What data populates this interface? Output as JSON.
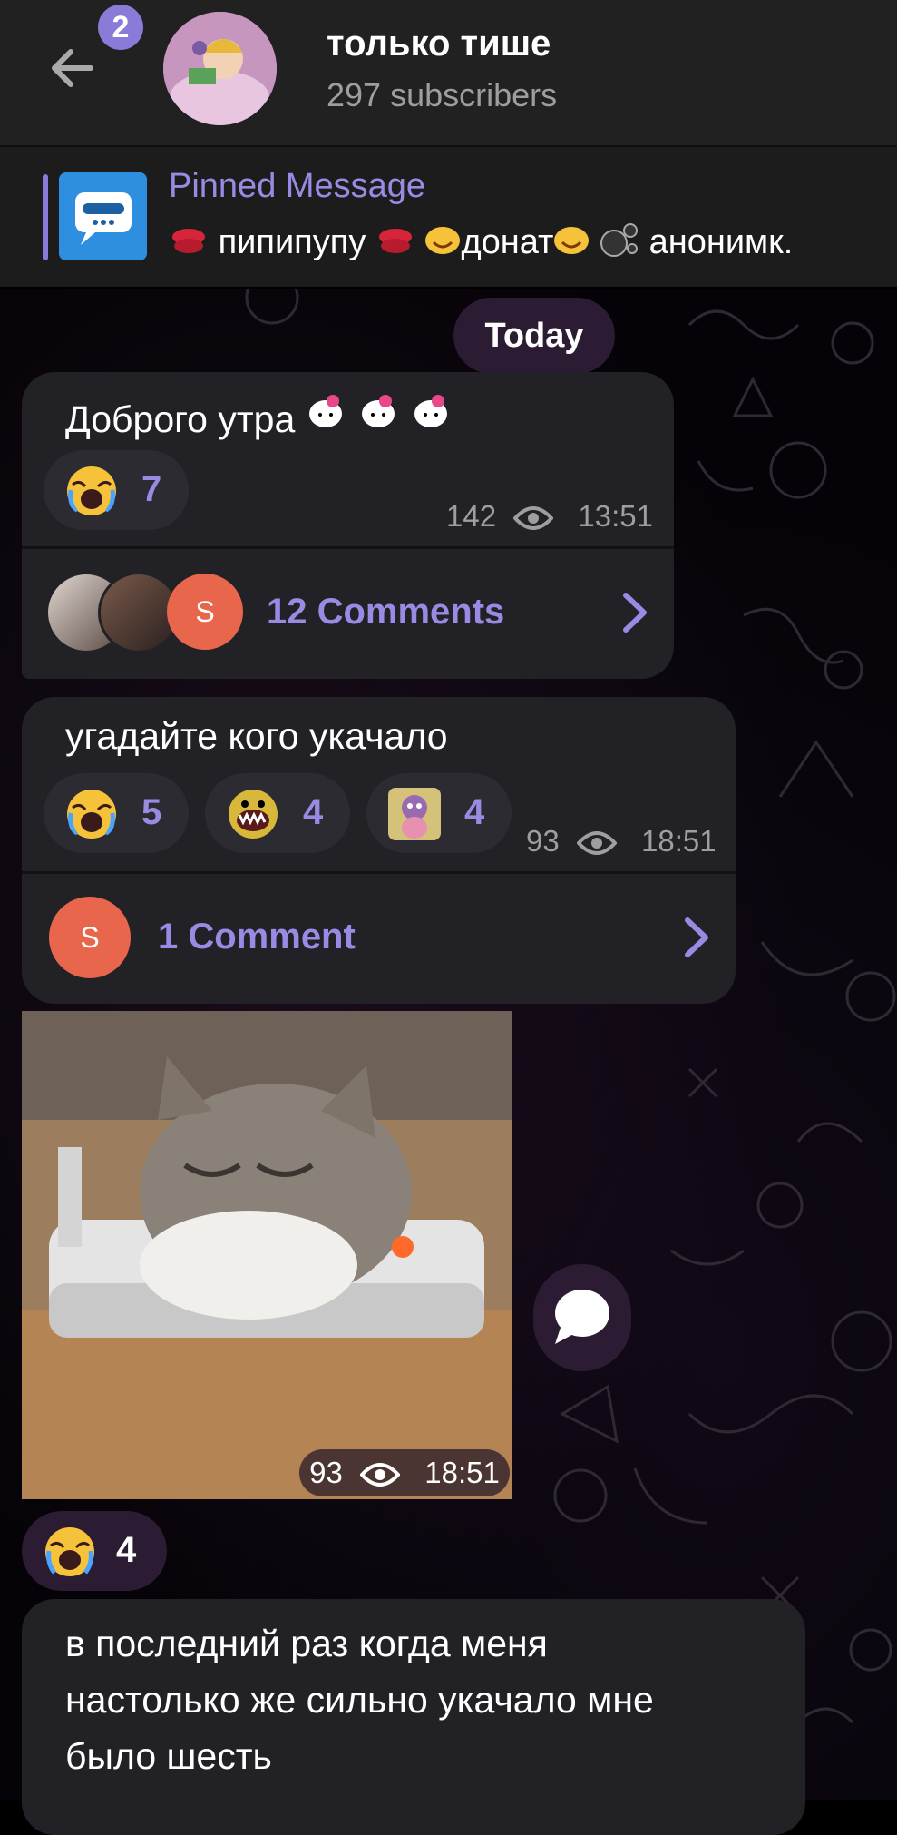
{
  "header": {
    "back_badge": "2",
    "channel_title": "только тише",
    "subscribers": "297 subscribers"
  },
  "pinned": {
    "label": "Pinned Message",
    "text_parts": [
      "пипипупу",
      "донат",
      "анонимк."
    ]
  },
  "date_separator": "Today",
  "messages": [
    {
      "text": "Доброго утра",
      "reactions": [
        {
          "icon": "crying-face-icon",
          "count": "7"
        }
      ],
      "views": "142",
      "time": "13:51",
      "comments_label": "12 Comments",
      "commenter_initial": "S"
    },
    {
      "text": "угадайте кого укачало",
      "reactions": [
        {
          "icon": "crying-face-icon",
          "count": "5"
        },
        {
          "icon": "screaming-face-icon",
          "count": "4"
        },
        {
          "icon": "monkey-sticker-icon",
          "count": "4"
        }
      ],
      "views": "93",
      "time": "18:51",
      "comments_label": "1 Comment",
      "commenter_initial": "S"
    },
    {
      "media": "kitten-sleeping-on-power-strip",
      "views": "93",
      "time": "18:51",
      "reactions": [
        {
          "icon": "crying-face-icon",
          "count": "4"
        }
      ]
    },
    {
      "text_lines": [
        "в последний раз когда меня",
        "настолько же сильно укачало мне",
        "было шесть"
      ]
    }
  ],
  "colors": {
    "accent": "#9a8ae3",
    "bubble": "#222125",
    "header": "#212121",
    "badge": "#8a7bd8"
  }
}
